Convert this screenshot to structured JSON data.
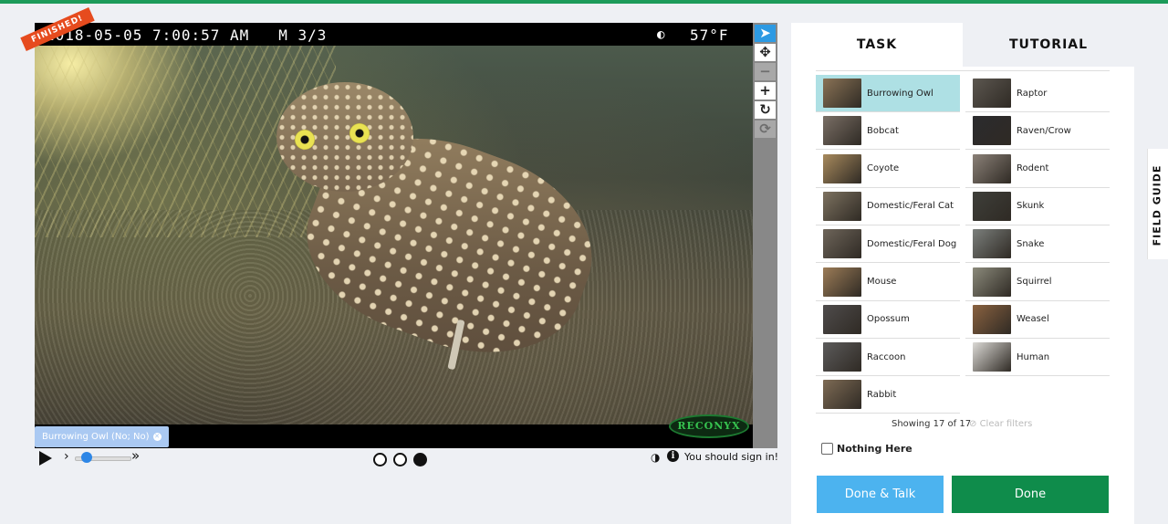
{
  "viewer": {
    "status_ribbon": "FINISHED!",
    "timestamp": "2018-05-05 7:00:57 AM   M 3/3",
    "moon_icon": "moon-phase-icon",
    "temperature": "57°F",
    "camera_brand": "RECONYX",
    "mark_label": "Burrowing Owl (No; No)",
    "tools": [
      "pointer-icon",
      "move-icon",
      "zoom-out-icon",
      "zoom-in-icon",
      "rotate-icon",
      "reset-icon"
    ]
  },
  "controls": {
    "frames": 3,
    "current_frame": 3,
    "sign_in_text": "You should sign in!",
    "speed_fraction": 0.25
  },
  "task_panel": {
    "tabs": {
      "task": "TASK",
      "tutorial": "TUTORIAL"
    },
    "choices": [
      {
        "label": "Burrowing Owl",
        "selected": true,
        "thumb_color": "#8a7356"
      },
      {
        "label": "Raptor",
        "thumb_color": "#5c5750"
      },
      {
        "label": "Bobcat",
        "thumb_color": "#7a6f66"
      },
      {
        "label": "Raven/Crow",
        "thumb_color": "#2b2b2e"
      },
      {
        "label": "Coyote",
        "thumb_color": "#a88a5d"
      },
      {
        "label": "Rodent",
        "thumb_color": "#8b8178"
      },
      {
        "label": "Domestic/Feral Cat",
        "thumb_color": "#7d7260"
      },
      {
        "label": "Skunk",
        "thumb_color": "#3e3f3a"
      },
      {
        "label": "Domestic/Feral Dog",
        "thumb_color": "#6e655a"
      },
      {
        "label": "Snake",
        "thumb_color": "#7b7f7c"
      },
      {
        "label": "Mouse",
        "thumb_color": "#9c7c57"
      },
      {
        "label": "Squirrel",
        "thumb_color": "#8b8a7b"
      },
      {
        "label": "Opossum",
        "thumb_color": "#4f4c4c"
      },
      {
        "label": "Weasel",
        "thumb_color": "#8a6240"
      },
      {
        "label": "Raccoon",
        "thumb_color": "#5c5b5b"
      },
      {
        "label": "Human",
        "thumb_color": "#dcdad6"
      },
      {
        "label": "Rabbit",
        "thumb_color": "#7e6b55"
      }
    ],
    "showing_text": "Showing 17 of 17",
    "clear_filters": "Clear filters",
    "nothing_here": "Nothing Here",
    "done_talk": "Done & Talk",
    "done": "Done"
  },
  "field_guide": "FIELD GUIDE",
  "colors": {
    "selected_choice": "#aee0e4",
    "done_button": "#0f8c4b",
    "done_talk_button": "#4cb3ef",
    "finished_ribbon": "#e64b1e"
  }
}
